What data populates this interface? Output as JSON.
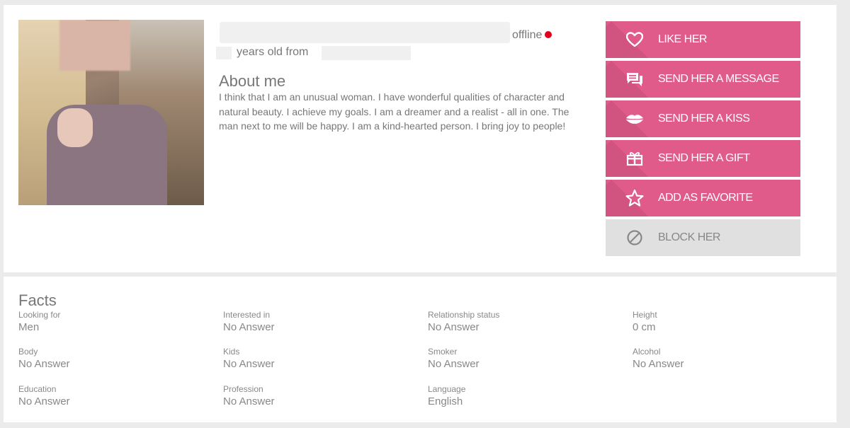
{
  "profile": {
    "status_text": "offline",
    "age_text": "years old from",
    "about_title": "About me",
    "about_text": "I think that I am an unusual woman. I have wonderful qualities of character and natural beauty. I achieve my goals. I am a dreamer and a realist - all in one. The man next to me will be happy. I am a kind-hearted person. I bring joy to people!",
    "status_color": "#e0001b"
  },
  "actions": [
    {
      "label": "LIKE HER",
      "icon": "heart-icon"
    },
    {
      "label": "SEND HER A MESSAGE",
      "icon": "message-icon"
    },
    {
      "label": "SEND HER A KISS",
      "icon": "lips-icon"
    },
    {
      "label": "SEND HER A GIFT",
      "icon": "gift-icon"
    },
    {
      "label": "ADD AS FAVORITE",
      "icon": "star-icon"
    },
    {
      "label": "BLOCK HER",
      "icon": "block-icon"
    }
  ],
  "accent_color": "#e05a8a",
  "facts": {
    "title": "Facts",
    "items": [
      {
        "label": "Looking for",
        "value": "Men"
      },
      {
        "label": "Interested in",
        "value": "No Answer"
      },
      {
        "label": "Relationship status",
        "value": "No Answer"
      },
      {
        "label": "Height",
        "value": "0 cm"
      },
      {
        "label": "Body",
        "value": "No Answer"
      },
      {
        "label": "Kids",
        "value": "No Answer"
      },
      {
        "label": "Smoker",
        "value": "No Answer"
      },
      {
        "label": "Alcohol",
        "value": "No Answer"
      },
      {
        "label": "Education",
        "value": "No Answer"
      },
      {
        "label": "Profession",
        "value": "No Answer"
      },
      {
        "label": "Language",
        "value": "English"
      }
    ]
  }
}
